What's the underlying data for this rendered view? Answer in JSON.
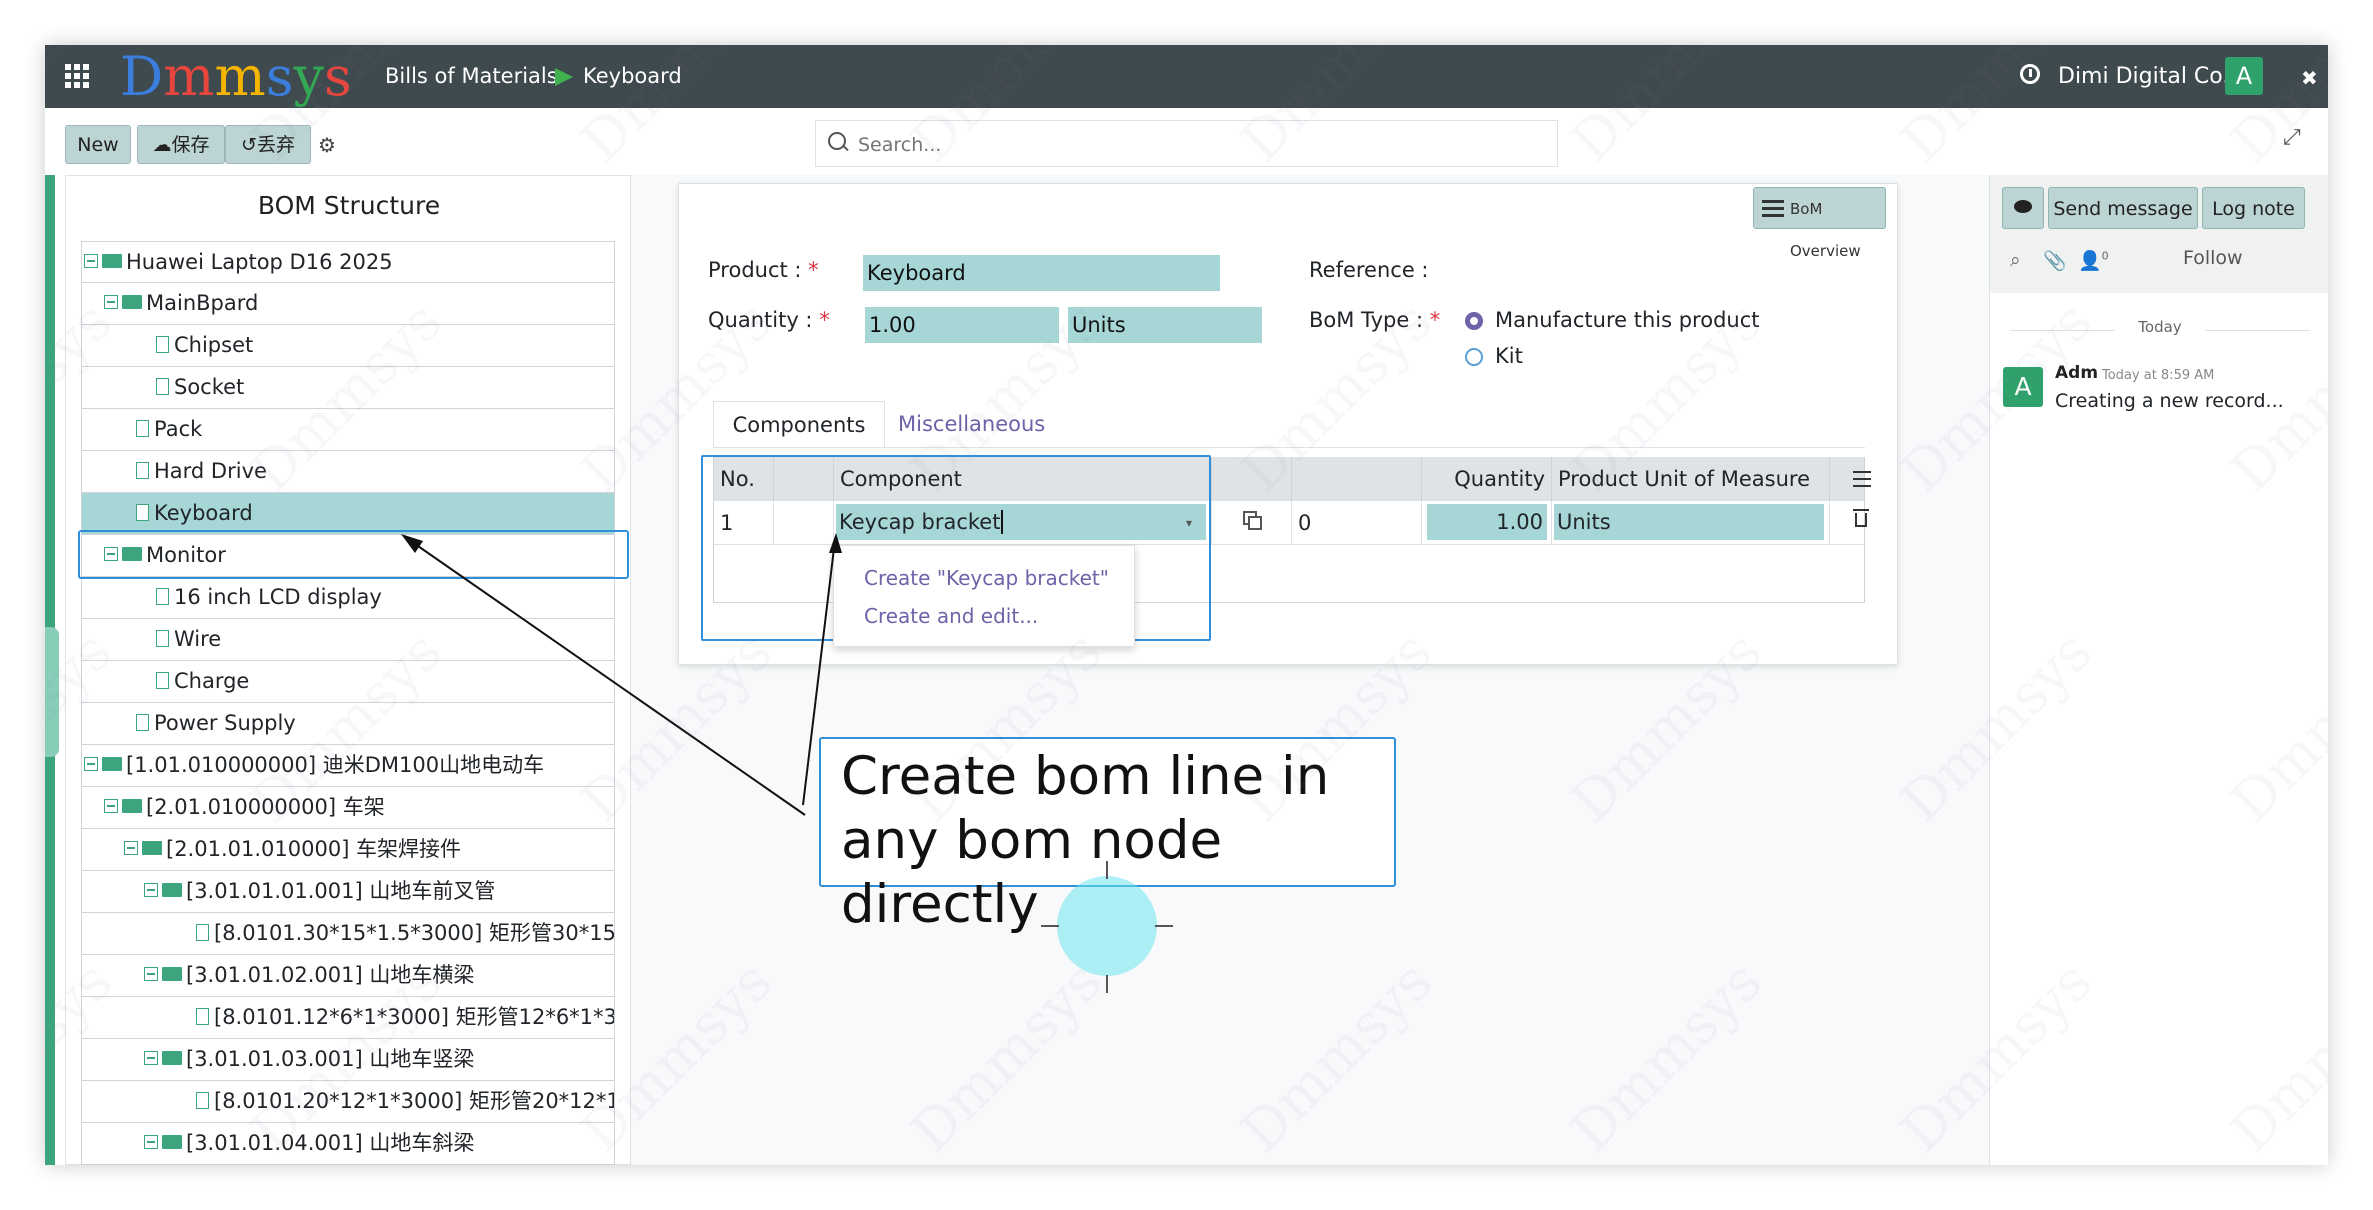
{
  "navbar": {
    "logo_letters": [
      {
        "ch": "D",
        "color": "#3b7ddd"
      },
      {
        "ch": "m",
        "color": "#e8453c"
      },
      {
        "ch": "m",
        "color": "#f4b400"
      },
      {
        "ch": "s",
        "color": "#3b7ddd"
      },
      {
        "ch": "y",
        "color": "#34a853"
      },
      {
        "ch": "s",
        "color": "#e8453c"
      }
    ],
    "breadcrumb": [
      "Bills of Materials",
      "Keyboard"
    ],
    "company": "Dimi Digital Co.",
    "avatar": "A"
  },
  "control_panel": {
    "new_label": "New",
    "save_label": "保存",
    "discard_label": "丢弃",
    "search_placeholder": "Search..."
  },
  "bom_structure": {
    "title": "BOM Structure",
    "rows": [
      {
        "label": "Huawei Laptop D16 2025",
        "depth": 0,
        "kind": "folder"
      },
      {
        "label": "MainBpard",
        "depth": 1,
        "kind": "folder"
      },
      {
        "label": "Chipset",
        "depth": 2,
        "kind": "file"
      },
      {
        "label": "Socket",
        "depth": 2,
        "kind": "file"
      },
      {
        "label": "Pack",
        "depth": 1,
        "kind": "file"
      },
      {
        "label": "Hard Drive",
        "depth": 1,
        "kind": "file"
      },
      {
        "label": "Keyboard",
        "depth": 1,
        "kind": "file",
        "selected": true
      },
      {
        "label": "Monitor",
        "depth": 1,
        "kind": "folder"
      },
      {
        "label": "16 inch LCD display",
        "depth": 2,
        "kind": "file"
      },
      {
        "label": "Wire",
        "depth": 2,
        "kind": "file"
      },
      {
        "label": "Charge",
        "depth": 2,
        "kind": "file"
      },
      {
        "label": "Power Supply",
        "depth": 1,
        "kind": "file"
      },
      {
        "label": "[1.01.010000000] 迪米DM100山地电动车",
        "depth": 0,
        "kind": "folder"
      },
      {
        "label": "[2.01.010000000] 车架",
        "depth": 1,
        "kind": "folder"
      },
      {
        "label": "[2.01.01.010000] 车架焊接件",
        "depth": 2,
        "kind": "folder"
      },
      {
        "label": "[3.01.01.01.001] 山地车前叉管",
        "depth": 3,
        "kind": "folder"
      },
      {
        "label": "[8.0101.30*15*1.5*3000] 矩形管30*15*...",
        "depth": 4,
        "kind": "file"
      },
      {
        "label": "[3.01.01.02.001] 山地车横梁",
        "depth": 3,
        "kind": "folder"
      },
      {
        "label": "[8.0101.12*6*1*3000] 矩形管12*6*1*30...",
        "depth": 4,
        "kind": "file"
      },
      {
        "label": "[3.01.01.03.001] 山地车竖梁",
        "depth": 3,
        "kind": "folder"
      },
      {
        "label": "[8.0101.20*12*1*3000] 矩形管20*12*1*...",
        "depth": 4,
        "kind": "file"
      },
      {
        "label": "[3.01.01.04.001] 山地车斜梁",
        "depth": 3,
        "kind": "folder"
      }
    ]
  },
  "form": {
    "overview_button": "BoM Overview",
    "product_label": "Product",
    "product_value": "Keyboard",
    "quantity_label": "Quantity",
    "quantity_value": "1.00",
    "uom_value": "Units",
    "reference_label": "Reference",
    "bom_type_label": "BoM Type",
    "bom_type_options": [
      "Manufacture this product",
      "Kit"
    ],
    "tabs": [
      "Components",
      "Miscellaneous"
    ],
    "table": {
      "headers": [
        "No.",
        "",
        "Component",
        "",
        "",
        "Quantity",
        "Product Unit of Measure"
      ],
      "row": {
        "no": "1",
        "component": "Keycap bracket",
        "value": "0",
        "quantity": "1.00",
        "uom": "Units"
      }
    },
    "dropdown": [
      "Create \"Keycap bracket\"",
      "Create and edit..."
    ]
  },
  "annotation": {
    "text": "Create bom line in any bom node directly"
  },
  "chatter": {
    "send_message": "Send message",
    "log_note": "Log note",
    "follower_count": "0",
    "follow": "Follow",
    "today": "Today",
    "message": {
      "avatar": "A",
      "author": "Adm",
      "time": "Today at 8:59 AM",
      "body": "Creating a new record..."
    }
  },
  "watermark": "Dmmsys",
  "colors": {
    "navbar": "#3f4a4e",
    "accent": "#3ca57e",
    "field_fill": "#a6d6d6",
    "highlight_border": "#2f8fd8",
    "link": "#6c63a8"
  }
}
